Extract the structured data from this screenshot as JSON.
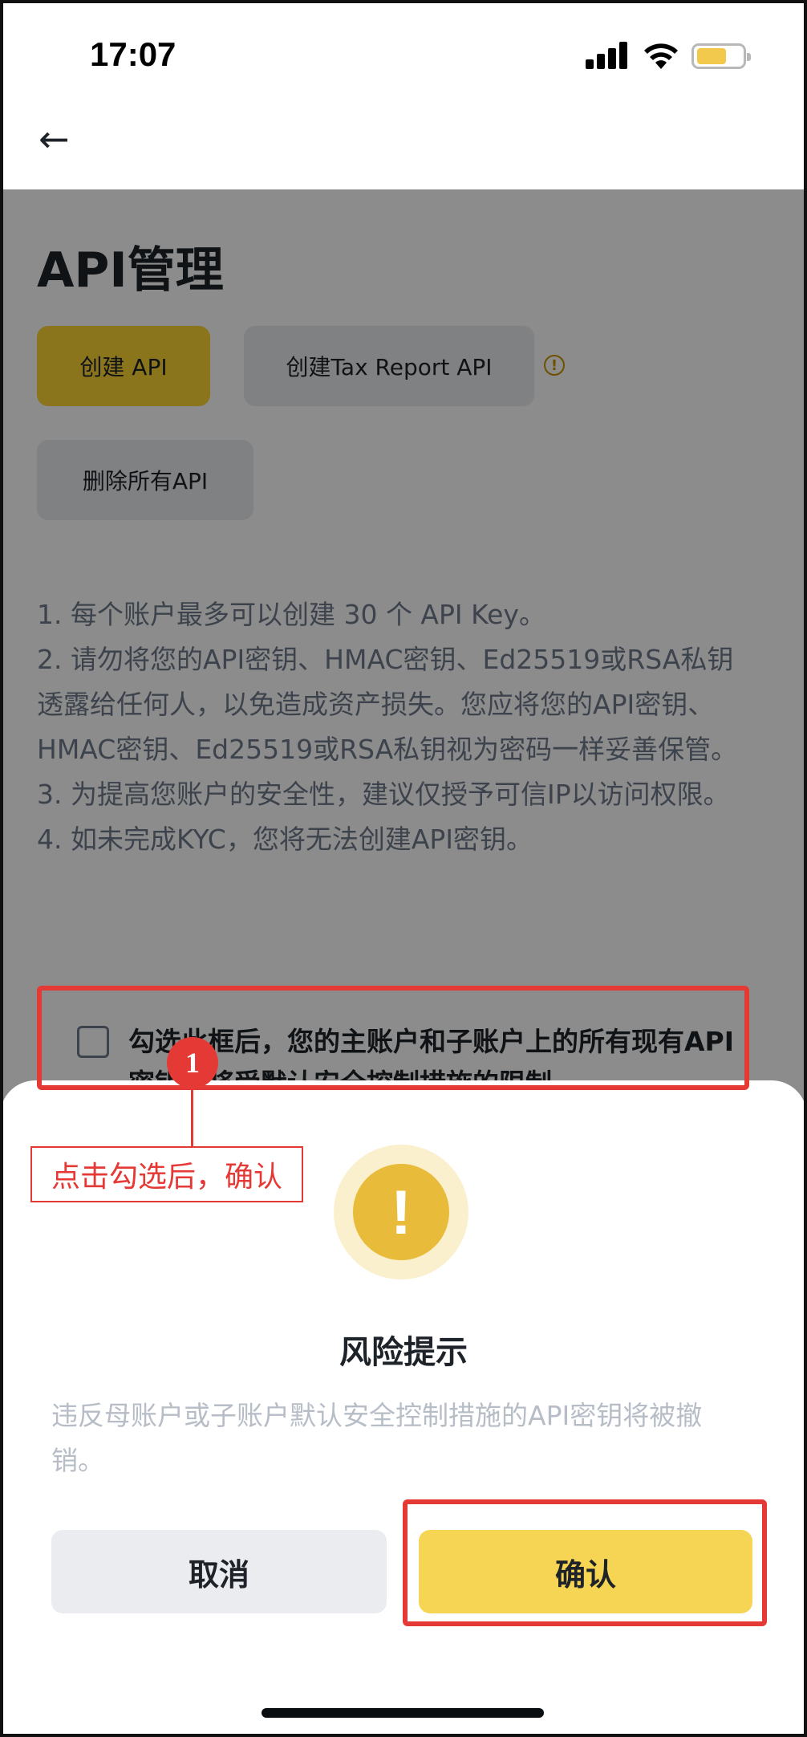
{
  "status_bar": {
    "time": "17:07",
    "signal_icon": "cellular-signal-icon",
    "wifi_icon": "wifi-icon",
    "battery_icon": "battery-icon",
    "battery_color": "#f2c94c"
  },
  "nav": {
    "back_icon": "arrow-left-icon",
    "back_glyph": "←"
  },
  "page": {
    "title": "API管理",
    "buttons": {
      "create_api": "创建 API",
      "create_tax_api": "创建Tax Report API",
      "delete_all_api": "删除所有API"
    },
    "info_glyph": "!",
    "notes": [
      "1. 每个账户最多可以创建 30 个 API Key。",
      "2. 请勿将您的API密钥、HMAC密钥、Ed25519或RSA私钥透露给任何人，以免造成资产损失。您应将您的API密钥、HMAC密钥、Ed25519或RSA私钥视为密码一样妥善保管。",
      "3. 为提高您账户的安全性，建议仅授予可信IP以访问权限。",
      "4. 如未完成KYC，您将无法创建API密钥。"
    ],
    "checkbox_text": "勾选此框后，您的主账户和子账户上的所有现有API密钥都将受默认安全控制措施的限制"
  },
  "dialog": {
    "warning_glyph": "!",
    "warning_icon": "exclamation-warning-icon",
    "title": "风险提示",
    "message": "违反母账户或子账户默认安全控制措施的API密钥将被撤销。",
    "cancel_label": "取消",
    "confirm_label": "确认"
  },
  "annotation": {
    "step_number": "1",
    "label": "点击勾选后，确认",
    "color": "#e53935"
  },
  "colors": {
    "brand_yellow": "#fcd535",
    "confirm_yellow": "#f5d553",
    "warning_yellow": "#e8bc3a",
    "text_primary": "#1e2329",
    "text_secondary": "#707a8a"
  }
}
